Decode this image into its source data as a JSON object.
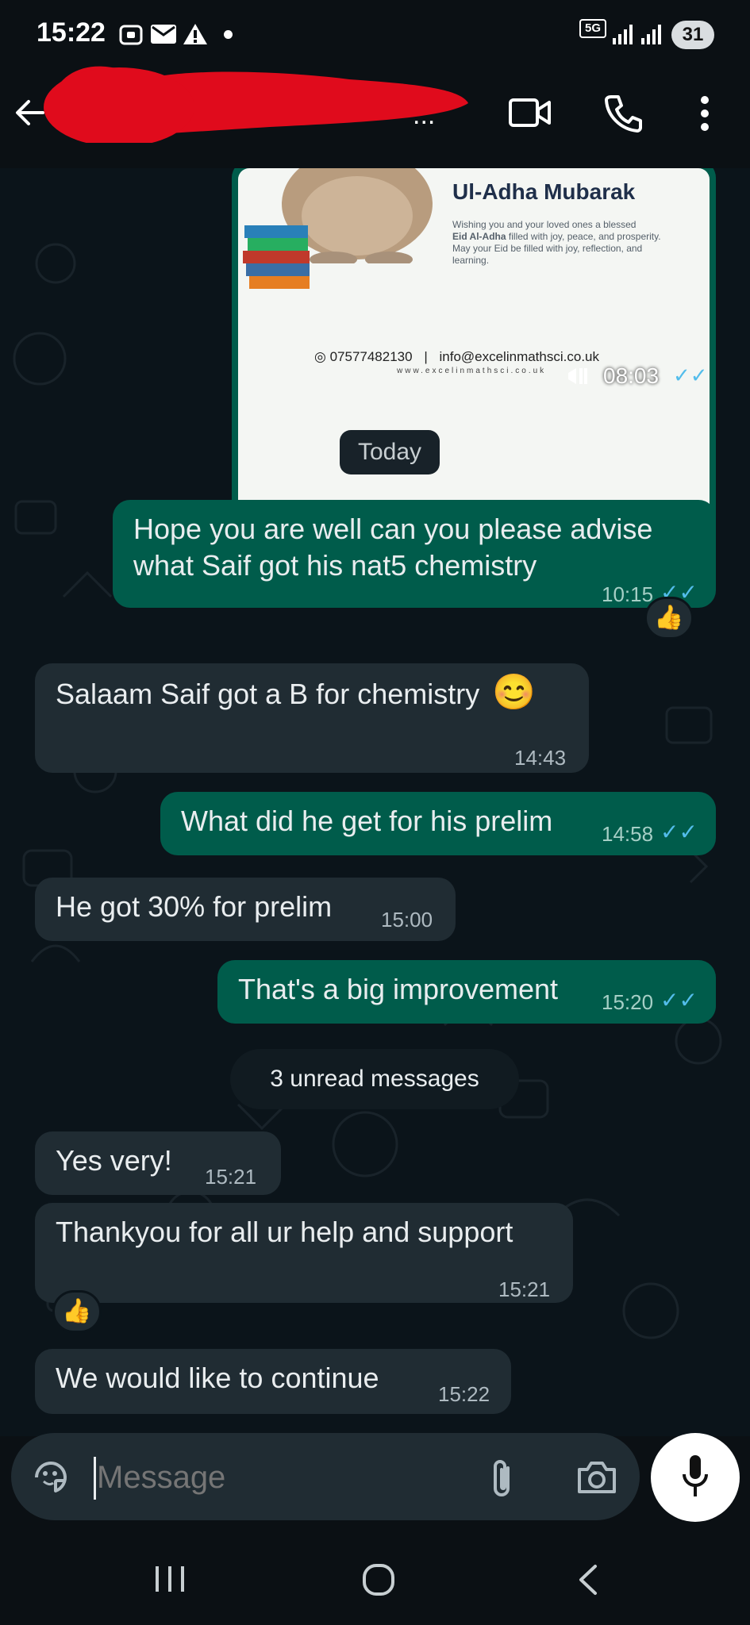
{
  "status_bar": {
    "time": "15:22",
    "icons": [
      "screenshot-icon",
      "mail-icon",
      "warning-icon",
      "dot-icon"
    ],
    "network": "5G",
    "battery": "31"
  },
  "header": {
    "contact_name_visible_fragment": "..."
  },
  "image_message": {
    "title": "Ul-Adha Mubarak",
    "greeting": "Wishing you and your loved ones a blessed",
    "greeting_bold": "Eid Al-Adha",
    "greeting_rest": "filled with joy, peace, and prosperity.",
    "greeting_line3": "May your Eid be filled with joy, reflection, and",
    "greeting_line4": "learning.",
    "phone": "07577482130",
    "separator": "|",
    "email": "info@excelinmathsci.co.uk",
    "website": "www.excelinmathsci.co.uk",
    "time": "08:03"
  },
  "date_divider": "Today",
  "messages": [
    {
      "text_line1": "Hope you are well can you please advise",
      "text_line2": "what Saif got his nat5 chemistry",
      "time": "10:15",
      "direction": "out"
    },
    {
      "text": "Salaam Saif got a B for chemistry",
      "emoji": "😊",
      "time": "14:43",
      "direction": "in"
    },
    {
      "text": "What did he get for his prelim",
      "time": "14:58",
      "direction": "out"
    },
    {
      "text": "He got 30% for prelim",
      "time": "15:00",
      "direction": "in"
    },
    {
      "text": "That's a big improvement",
      "time": "15:20",
      "direction": "out"
    },
    {
      "text": "Yes very!",
      "time": "15:21",
      "direction": "in"
    },
    {
      "text": "Thankyou for all ur help and support",
      "time": "15:21",
      "direction": "in"
    },
    {
      "text": "We would like to continue",
      "time": "15:22",
      "direction": "in"
    }
  ],
  "reactions": [
    "👍",
    "👍"
  ],
  "unread_divider": "3 unread messages",
  "composer": {
    "placeholder": "Message"
  },
  "colors": {
    "outgoing_bubble": "#005c4b",
    "incoming_bubble": "#202c33",
    "read_ticks": "#53bdeb",
    "background": "#0b141a"
  }
}
